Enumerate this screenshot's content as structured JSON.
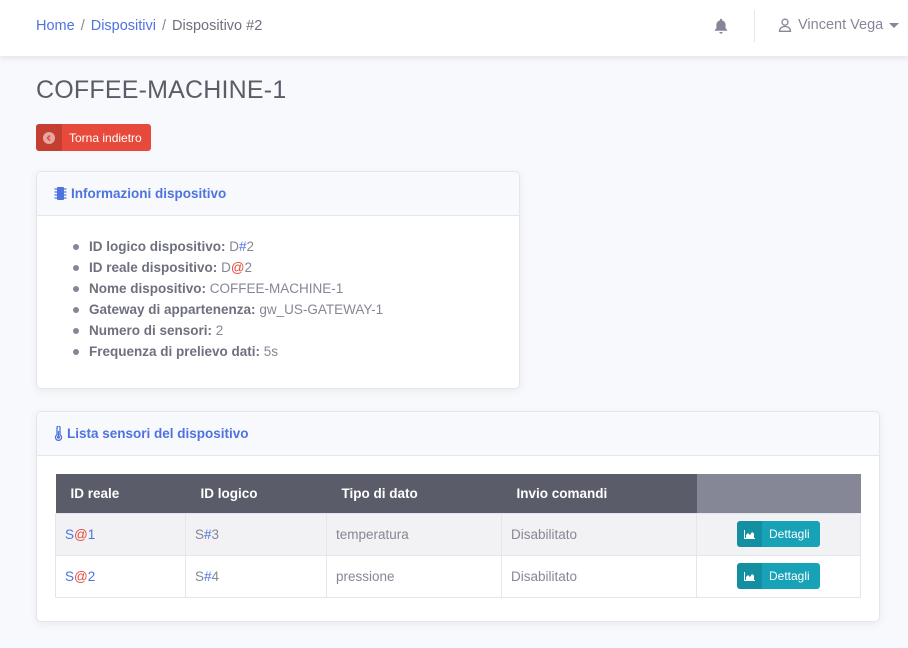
{
  "breadcrumb": {
    "home": "Home",
    "sep1": "/",
    "devices": "Dispositivi",
    "sep2": "/",
    "current": "Dispositivo #2"
  },
  "topbar": {
    "user_name": "Vincent Vega",
    "icons": [
      "bell-icon",
      "user-icon",
      "caret-down-icon"
    ]
  },
  "page_title": "COFFEE-MACHINE-1",
  "back_button": {
    "label": "Torna indietro",
    "icon": "arrow-circle-left-icon"
  },
  "info_card": {
    "title": "Informazioni dispositivo",
    "icon": "microchip-icon",
    "items": [
      {
        "label": "ID logico dispositivo:",
        "prefix": "D",
        "symbol": "#",
        "suffix": "2"
      },
      {
        "label": "ID reale dispositivo:",
        "prefix": "D",
        "symbol": "@",
        "suffix": "2"
      },
      {
        "label": "Nome dispositivo:",
        "value": "COFFEE-MACHINE-1"
      },
      {
        "label": "Gateway di appartenenza:",
        "value": "gw_US-GATEWAY-1"
      },
      {
        "label": "Numero di sensori:",
        "value": "2"
      },
      {
        "label": "Frequenza di prelievo dati:",
        "value": "5s"
      }
    ]
  },
  "sensors_card": {
    "title": "Lista sensori del dispositivo",
    "icon": "thermometer-icon",
    "columns": [
      "ID reale",
      "ID logico",
      "Tipo di dato",
      "Invio comandi",
      ""
    ],
    "rows": [
      {
        "real_prefix": "S",
        "real_symbol": "@",
        "real_suffix": "1",
        "log_prefix": "S",
        "log_symbol": "#",
        "log_suffix": "3",
        "type": "temperatura",
        "commands": "Disabilitato",
        "button": "Dettagli"
      },
      {
        "real_prefix": "S",
        "real_symbol": "@",
        "real_suffix": "2",
        "log_prefix": "S",
        "log_symbol": "#",
        "log_suffix": "4",
        "type": "pressione",
        "commands": "Disabilitato",
        "button": "Dettagli"
      }
    ]
  },
  "colors": {
    "primary": "#4e73df",
    "danger": "#e74a3b",
    "info": "#17a2b8",
    "table_header": "#5a5c69"
  }
}
